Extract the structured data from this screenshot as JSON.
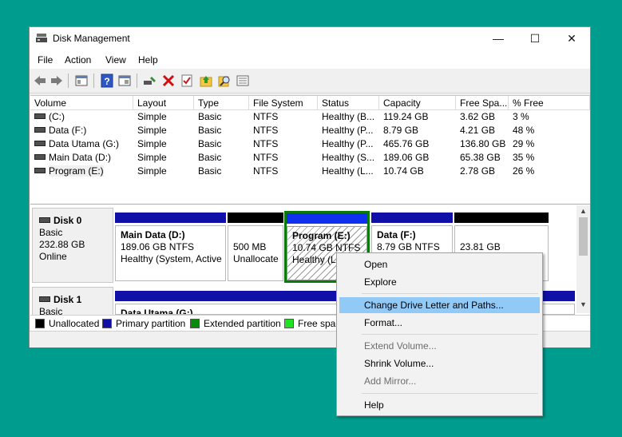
{
  "window": {
    "title": "Disk Management",
    "minimize": "—",
    "maximize": "☐",
    "close": "✕"
  },
  "menu": [
    "File",
    "Action",
    "View",
    "Help"
  ],
  "toolbar_icons": [
    "back-arrow-icon",
    "forward-arrow-icon",
    "console-tree-icon",
    "help-icon",
    "properties-icon",
    "connect-icon",
    "delete-icon",
    "check-icon",
    "folder-up-icon",
    "search-icon",
    "list-icon"
  ],
  "volumes": {
    "headers": [
      "Volume",
      "Layout",
      "Type",
      "File System",
      "Status",
      "Capacity",
      "Free Spa...",
      "% Free"
    ],
    "rows": [
      [
        "(C:)",
        "Simple",
        "Basic",
        "NTFS",
        "Healthy (B...",
        "119.24 GB",
        "3.62 GB",
        "3 %"
      ],
      [
        "Data (F:)",
        "Simple",
        "Basic",
        "NTFS",
        "Healthy (P...",
        "8.79 GB",
        "4.21 GB",
        "48 %"
      ],
      [
        "Data Utama (G:)",
        "Simple",
        "Basic",
        "NTFS",
        "Healthy (P...",
        "465.76 GB",
        "136.80 GB",
        "29 %"
      ],
      [
        "Main Data (D:)",
        "Simple",
        "Basic",
        "NTFS",
        "Healthy (S...",
        "189.06 GB",
        "65.38 GB",
        "35 %"
      ],
      [
        "Program (E:)",
        "Simple",
        "Basic",
        "NTFS",
        "Healthy (L...",
        "10.74 GB",
        "2.78 GB",
        "26 %"
      ]
    ]
  },
  "disk0": {
    "name": "Disk 0",
    "type": "Basic",
    "size": "232.88 GB",
    "state": "Online",
    "partitions": [
      {
        "name": "Main Data  (D:)",
        "size": "189.06 GB NTFS",
        "status": "Healthy (System, Active"
      },
      {
        "name": "",
        "size": "500 MB",
        "status": "Unallocate"
      },
      {
        "name": "Program  (E:)",
        "size": "10.74 GB NTFS",
        "status": "Healthy (L"
      },
      {
        "name": "Data  (F:)",
        "size": "8.79 GB NTFS",
        "status": ""
      },
      {
        "name": "",
        "size": "23.81 GB",
        "status": ""
      }
    ]
  },
  "disk1": {
    "name": "Disk 1",
    "type": "Basic",
    "partition_name": "Data Utama  (G:)"
  },
  "legend": [
    {
      "label": "Unallocated",
      "color": "#000000"
    },
    {
      "label": "Primary partition",
      "color": "#1010a8"
    },
    {
      "label": "Extended partition",
      "color": "#0a8a0a"
    },
    {
      "label": "Free spac",
      "color": "#22e022"
    }
  ],
  "context_menu": {
    "open": "Open",
    "explore": "Explore",
    "change_letter": "Change Drive Letter and Paths...",
    "format": "Format...",
    "extend": "Extend Volume...",
    "shrink": "Shrink Volume...",
    "mirror": "Add Mirror...",
    "help": "Help"
  }
}
